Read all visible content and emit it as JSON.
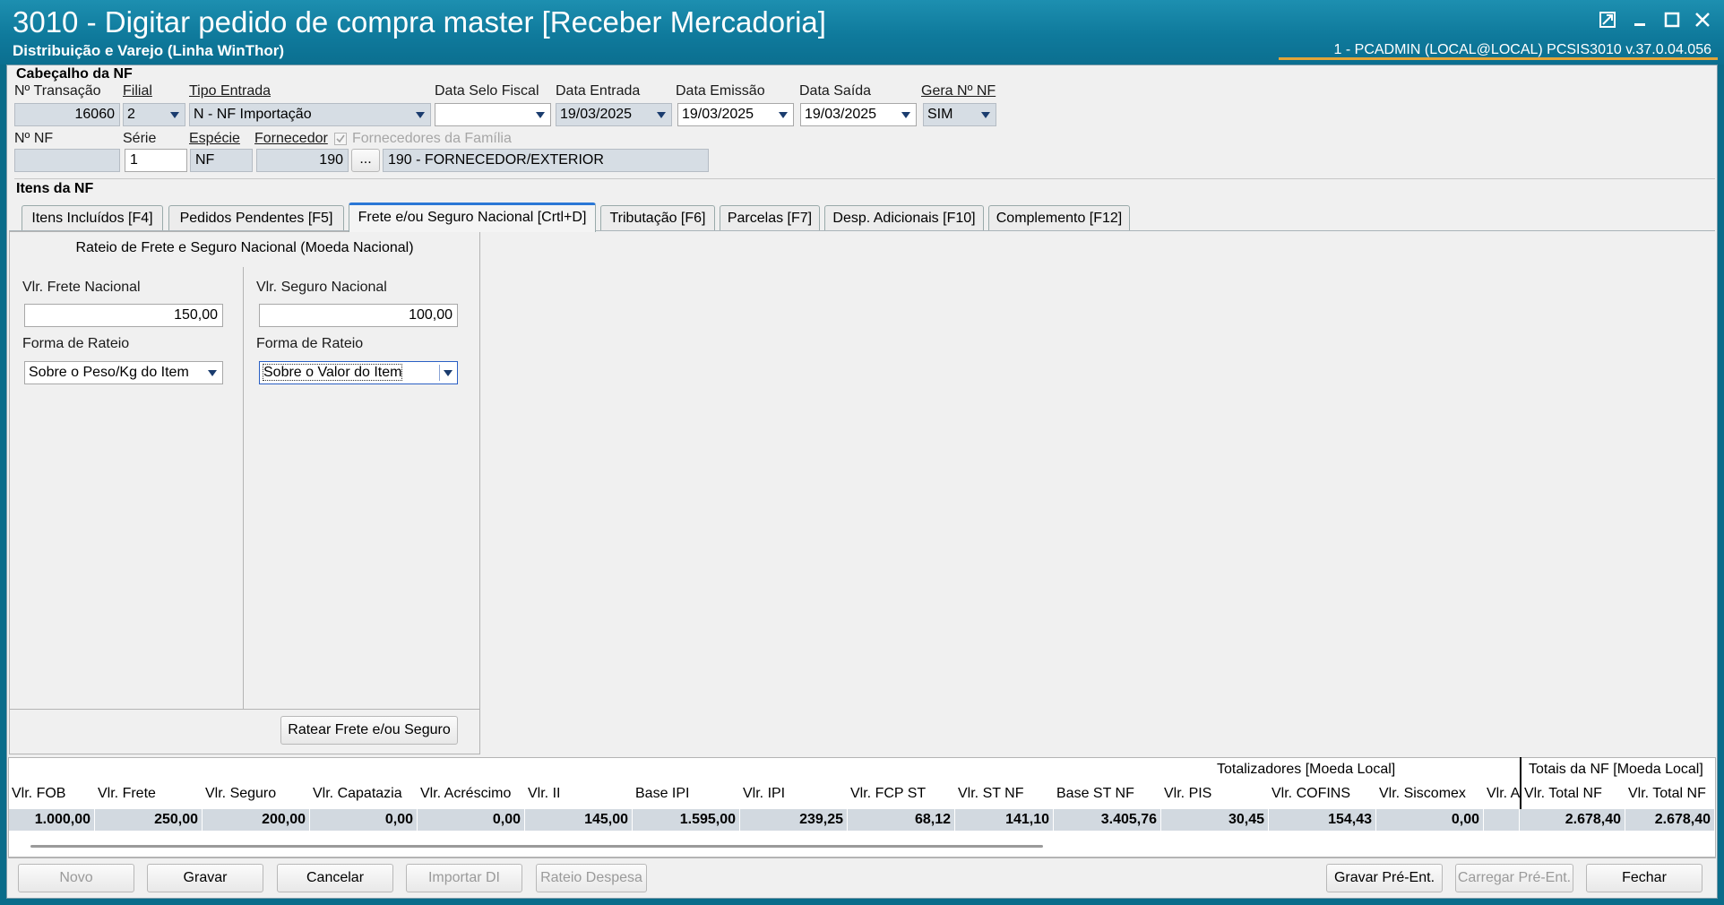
{
  "window": {
    "title": "3010 - Digitar pedido de compra master [Receber Mercadoria]",
    "subtitle": "Distribuição e Varejo (Linha WinThor)",
    "user_info": "1 - PCADMIN (LOCAL@LOCAL)   PCSIS3010  v.37.0.04.056"
  },
  "header": {
    "group_label": "Cabeçalho da NF",
    "transacao_label": "Nº Transação",
    "transacao_value": "16060",
    "filial_label": "Filial",
    "filial_value": "2",
    "tipo_entrada_label": "Tipo Entrada",
    "tipo_entrada_value": "N - NF Importação",
    "data_selo_label": "Data Selo Fiscal",
    "data_selo_value": "",
    "data_entrada_label": "Data Entrada",
    "data_entrada_value": "19/03/2025",
    "data_emissao_label": "Data Emissão",
    "data_emissao_value": "19/03/2025",
    "data_saida_label": "Data Saída",
    "data_saida_value": "19/03/2025",
    "gera_nf_label": "Gera Nº NF",
    "gera_nf_value": "SIM",
    "num_nf_label": "Nº NF",
    "num_nf_value": "",
    "serie_label": "Série",
    "serie_value": "1",
    "especie_label": "Espécie",
    "especie_value": "NF",
    "fornecedor_label": "Fornecedor",
    "fornecedor_code": "190",
    "fornecedor_btn": "...",
    "fornecedor_name": "190 - FORNECEDOR/EXTERIOR",
    "fornecedores_familia_label": "Fornecedores da Família"
  },
  "items": {
    "group_label": "Itens da NF",
    "tabs": [
      {
        "label": "Itens Incluídos [F4]"
      },
      {
        "label": "Pedidos Pendentes [F5]"
      },
      {
        "label": "Frete e/ou Seguro Nacional [Crtl+D]"
      },
      {
        "label": "Tributação [F6]"
      },
      {
        "label": "Parcelas [F7]"
      },
      {
        "label": "Desp. Adicionais [F10]"
      },
      {
        "label": "Complemento [F12]"
      }
    ]
  },
  "rateio": {
    "title": "Rateio de Frete e Seguro Nacional (Moeda Nacional)",
    "frete_label": "Vlr. Frete Nacional",
    "frete_value": "150,00",
    "frete_forma_label": "Forma de Rateio",
    "frete_forma_value": "Sobre o Peso/Kg do Item",
    "seguro_label": "Vlr. Seguro Nacional",
    "seguro_value": "100,00",
    "seguro_forma_label": "Forma de Rateio",
    "seguro_forma_value": "Sobre o Valor do Item",
    "ratear_button": "Ratear Frete e/ou Seguro"
  },
  "totals": {
    "group_local": "Totalizadores [Moeda Local]",
    "group_nf": "Totais da NF [Moeda Local]",
    "columns": [
      {
        "header": "Vlr. FOB",
        "value": "1.000,00"
      },
      {
        "header": "Vlr. Frete",
        "value": "250,00"
      },
      {
        "header": "Vlr. Seguro",
        "value": "200,00"
      },
      {
        "header": "Vlr. Capatazia",
        "value": "0,00"
      },
      {
        "header": "Vlr. Acréscimo",
        "value": "0,00"
      },
      {
        "header": "Vlr. II",
        "value": "145,00"
      },
      {
        "header": "Base IPI",
        "value": "1.595,00"
      },
      {
        "header": "Vlr. IPI",
        "value": "239,25"
      },
      {
        "header": "Vlr. FCP ST",
        "value": "68,12"
      },
      {
        "header": "Vlr. ST NF",
        "value": "141,10"
      },
      {
        "header": "Base ST NF",
        "value": "3.405,76"
      },
      {
        "header": "Vlr. PIS",
        "value": "30,45"
      },
      {
        "header": "Vlr. COFINS",
        "value": "154,43"
      },
      {
        "header": "Vlr. Siscomex",
        "value": "0,00"
      },
      {
        "header": "Vlr. A",
        "value": ""
      }
    ],
    "nf_columns": [
      {
        "header": "Vlr. Total NF",
        "value": "2.678,40"
      },
      {
        "header": "Vlr. Total NF",
        "value": "2.678,40"
      }
    ]
  },
  "footer": {
    "novo": "Novo",
    "gravar": "Gravar",
    "cancelar": "Cancelar",
    "importar_di": "Importar DI",
    "rateio_despesa": "Rateio Despesa",
    "gravar_pre": "Gravar Pré-Ent.",
    "carregar_pre": "Carregar Pré-Ent.",
    "fechar": "Fechar"
  },
  "colors": {
    "titlebar": "#0f7a9c",
    "accent_tab": "#2a77d6",
    "readonly_field": "#d6dde4"
  }
}
